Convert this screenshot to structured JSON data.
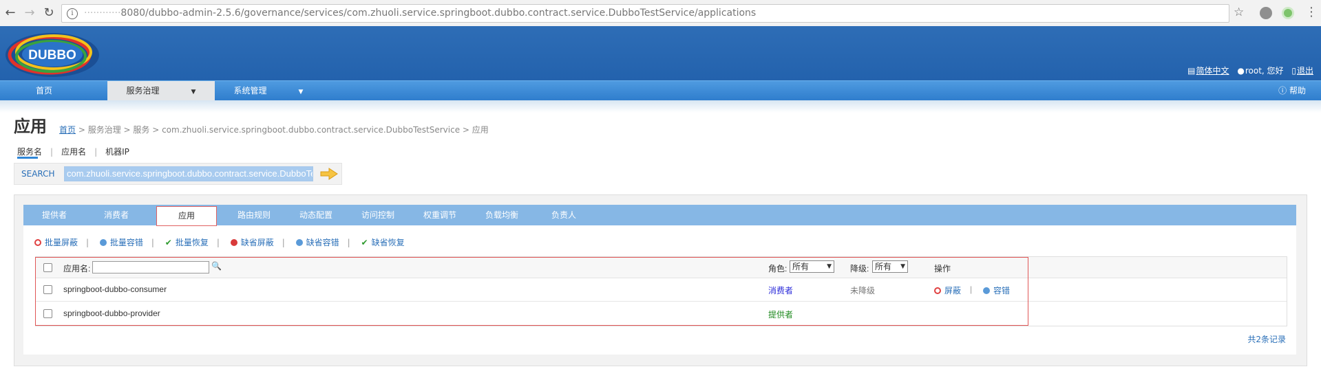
{
  "browser": {
    "url_host": "············",
    "url_path": "8080/dubbo-admin-2.5.6/governance/services/com.zhuoli.service.springboot.dubbo.contract.service.DubboTestService/applications"
  },
  "header": {
    "logo_text": "DUBBO",
    "lang_link": "简体中文",
    "greeting": "root, 您好",
    "logout": "退出"
  },
  "mainnav": {
    "home": "首页",
    "service_gov": "服务治理",
    "sys_mgmt": "系统管理",
    "help": "帮助"
  },
  "page": {
    "title": "应用",
    "breadcrumb_home": "首页",
    "breadcrumb_rest": " > 服务治理 > 服务 > com.zhuoli.service.springboot.dubbo.contract.service.DubboTestService > 应用"
  },
  "search": {
    "tabs": [
      "服务名",
      "应用名",
      "机器IP"
    ],
    "label": "SEARCH",
    "value": "com.zhuoli.service.springboot.dubbo.contract.service.DubboTestService"
  },
  "tabs": [
    "提供者",
    "消费者",
    "应用",
    "路由规则",
    "动态配置",
    "访问控制",
    "权重调节",
    "负载均衡",
    "负责人"
  ],
  "actions": [
    "批量屏蔽",
    "批量容错",
    "批量恢复",
    "缺省屏蔽",
    "缺省容错",
    "缺省恢复"
  ],
  "table": {
    "col_app": "应用名:",
    "col_role": "角色:",
    "role_filter": "所有",
    "col_degrade": "降级:",
    "degrade_filter": "所有",
    "col_ops": "操作",
    "rows": [
      {
        "app": "springboot-dubbo-consumer",
        "role": "消费者",
        "degrade": "未降级",
        "op1": "屏蔽",
        "op2": "容错"
      },
      {
        "app": "springboot-dubbo-provider",
        "role": "提供者",
        "degrade": "",
        "op1": "",
        "op2": ""
      }
    ]
  },
  "total": "共2条记录",
  "colors": {
    "header": "#2362ad",
    "nav": "#3a87d6",
    "tabbar": "#86b7e5",
    "link": "#2a6fb8",
    "consumer": "#2b2bd9",
    "provider": "#1f8a1f",
    "highlight": "#e05555"
  }
}
